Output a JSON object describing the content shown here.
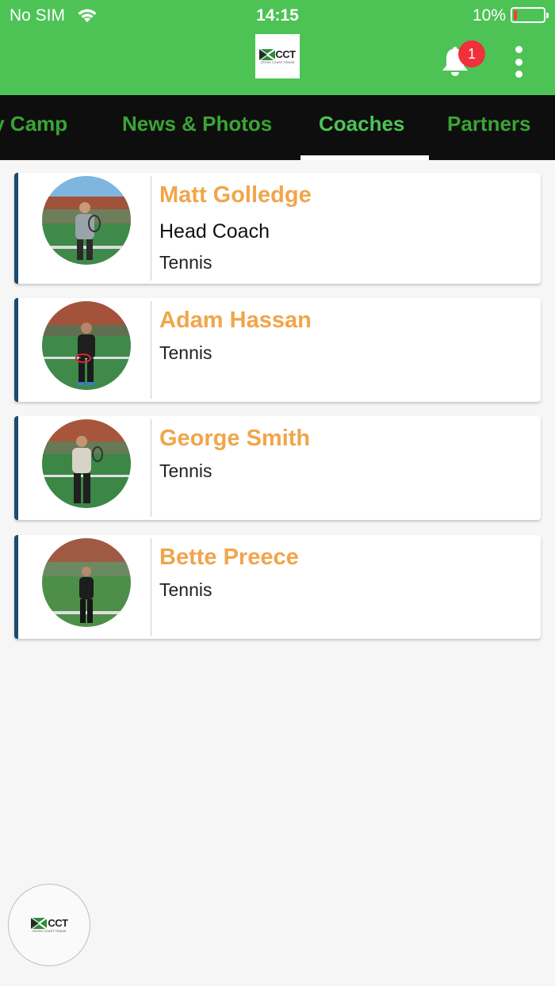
{
  "status_bar": {
    "carrier": "No SIM",
    "time": "14:15",
    "battery": "10%"
  },
  "header": {
    "logo_text": "CCT",
    "logo_subtext": "CROSS COURT TENNIS",
    "notification_count": "1",
    "brand_color": "#4dc356"
  },
  "tabs": [
    {
      "label": "Day Camp",
      "active": false
    },
    {
      "label": "News & Photos",
      "active": false
    },
    {
      "label": "Coaches",
      "active": true
    },
    {
      "label": "Partners",
      "active": false
    }
  ],
  "coaches": [
    {
      "name": "Matt Golledge",
      "role": "Head Coach",
      "sport": "Tennis"
    },
    {
      "name": "Adam Hassan",
      "role": "",
      "sport": "Tennis"
    },
    {
      "name": "George Smith",
      "role": "",
      "sport": "Tennis"
    },
    {
      "name": "Bette Preece",
      "role": "",
      "sport": "Tennis"
    }
  ],
  "fab": {
    "logo_text": "CCT",
    "logo_subtext": "CROSS COURT TENNIS"
  },
  "colors": {
    "accent_name": "#f1a54a",
    "card_border": "#1c4b6b",
    "tab_bar": "#0e0e0e",
    "badge": "#f0303a"
  }
}
